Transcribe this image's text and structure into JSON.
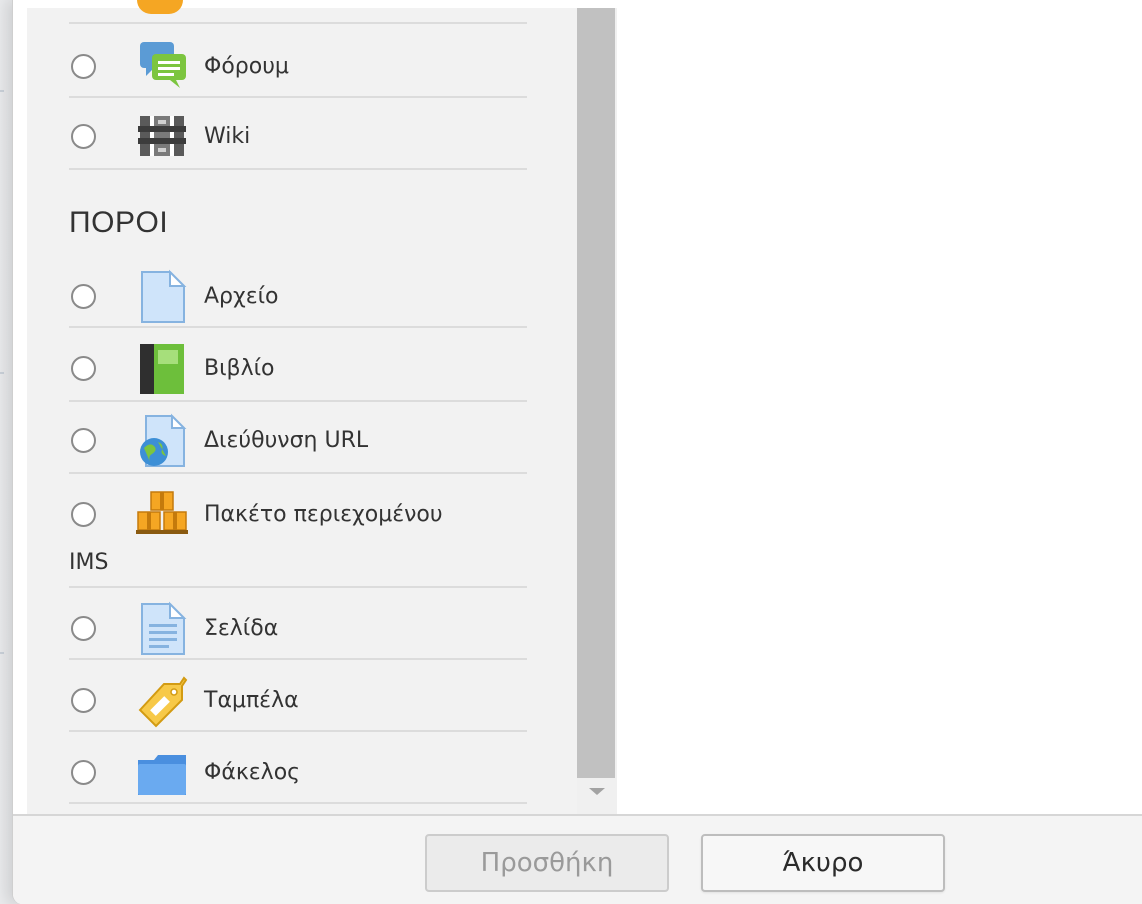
{
  "section": {
    "resources_heading": "ΠΟΡΟΙ"
  },
  "items": [
    {
      "label": "Φόρουμ",
      "icon": "forum-icon"
    },
    {
      "label": "Wiki",
      "icon": "wiki-icon"
    },
    {
      "label": "Αρχείο",
      "icon": "file-icon"
    },
    {
      "label": "Βιβλίο",
      "icon": "book-icon"
    },
    {
      "label": "Διεύθυνση URL",
      "icon": "url-icon"
    },
    {
      "label": "Πακέτο περιεχομένου",
      "label_wrap": "IMS",
      "icon": "ims-package-icon"
    },
    {
      "label": "Σελίδα",
      "icon": "page-icon"
    },
    {
      "label": "Ταμπέλα",
      "icon": "label-tag-icon"
    },
    {
      "label": "Φάκελος",
      "icon": "folder-icon"
    }
  ],
  "footer": {
    "add_label": "Προσθήκη",
    "cancel_label": "Άκυρο"
  }
}
